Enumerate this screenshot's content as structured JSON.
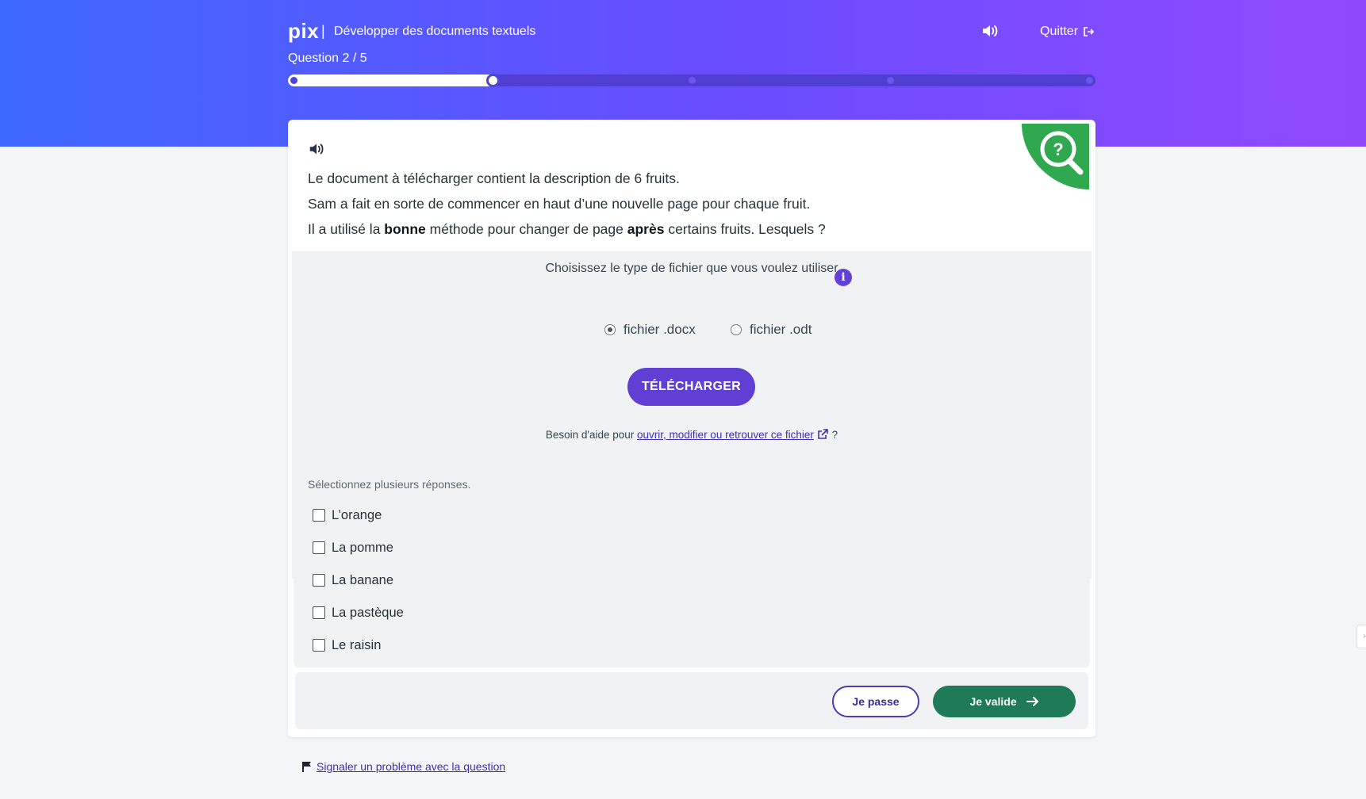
{
  "header": {
    "logo": "pix",
    "separator": "|",
    "title": "Développer des documents textuels",
    "quit_label": "Quitter",
    "question_count": "Question 2 / 5"
  },
  "progress": {
    "current": 2,
    "total": 5
  },
  "challenge": {
    "line1": "Le document à télécharger contient la description de 6 fruits.",
    "line2": "Sam a fait en sorte de commencer en haut d’une nouvelle page pour chaque fruit.",
    "line3_pre": "Il a utilisé la ",
    "line3_bold1": "bonne",
    "line3_mid": " méthode pour changer de page ",
    "line3_bold2": "après",
    "line3_post": " certains fruits. Lesquels ?"
  },
  "download": {
    "choose_label": "Choisissez le type de fichier que vous voulez utiliser",
    "option_docx": "fichier .docx",
    "option_odt": "fichier .odt",
    "selected": "docx",
    "button_label": "TÉLÉCHARGER",
    "help_prefix": "Besoin d'aide pour ",
    "help_link": "ouvrir, modifier ou retrouver ce fichier",
    "help_suffix": " ?"
  },
  "answers": {
    "hint": "Sélectionnez plusieurs réponses.",
    "options": [
      "L’orange",
      "La pomme",
      "La banane",
      "La pastèque",
      "Le raisin"
    ]
  },
  "actions": {
    "skip_label": "Je passe",
    "validate_label": "Je valide"
  },
  "report_label": "Signaler un problème avec la question",
  "colors": {
    "primary": "#5f3fd4",
    "validate": "#1f7a57",
    "badge_green": "#2fa84f"
  }
}
